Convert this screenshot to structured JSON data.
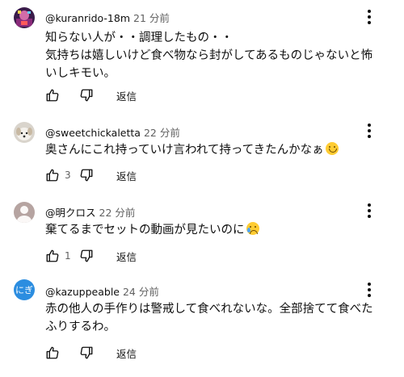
{
  "comments": [
    {
      "handle": "@kuranrido-18m",
      "time": "21 分前",
      "lines": [
        "知らない人が・・調理したもの・・",
        "気持ちは嬉しいけど食べ物なら封がしてあるものじゃないと怖",
        "いしキモい。"
      ],
      "like_count": "",
      "reply_label": "返信",
      "avatar_icon": "gamer-avatar-icon"
    },
    {
      "handle": "@sweetchickaletta",
      "time": "22 分前",
      "lines": [
        "奥さんにこれ持っていけ言われて持ってきたんかなぁ"
      ],
      "emoji": "smiling-face-emoji",
      "like_count": "3",
      "reply_label": "返信",
      "avatar_icon": "dog-avatar-icon"
    },
    {
      "handle": "@明クロス",
      "time": "22 分前",
      "lines": [
        "棄てるまでセットの動画が見たいのに"
      ],
      "emoji": "crying-face-emoji",
      "like_count": "1",
      "reply_label": "返信",
      "avatar_icon": "default-person-avatar-icon"
    },
    {
      "handle": "@kazuppeable",
      "time": "24 分前",
      "lines": [
        "赤の他人の手作りは警戒して食べれないな。全部捨てて食べた",
        "ふりするわ。"
      ],
      "like_count": "",
      "reply_label": "返信",
      "avatar_text": "にぎ",
      "avatar_color": "#2b8de0"
    }
  ],
  "colors": {
    "text": "#0f0f0f",
    "secondary": "#606060",
    "accent": "#2b8de0"
  }
}
